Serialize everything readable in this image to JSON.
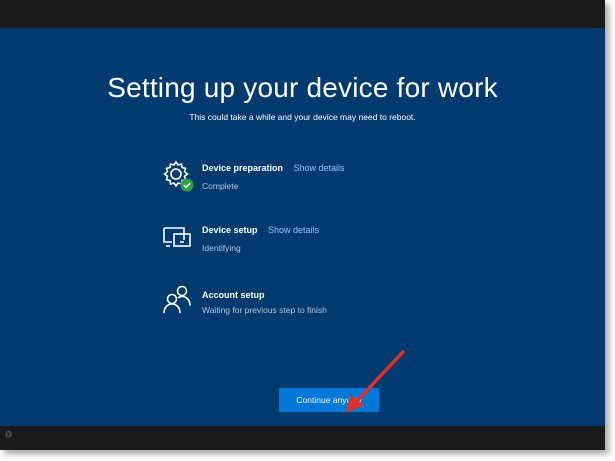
{
  "setup": {
    "title": "Setting up your device for work",
    "subtitle": "This could take a while and your device may need to reboot."
  },
  "steps": [
    {
      "icon": "gear-check-icon",
      "title": "Device preparation",
      "link": "Show details",
      "status": "Complete"
    },
    {
      "icon": "device-icon",
      "title": "Device setup",
      "link": "Show details",
      "status": "Identifying"
    },
    {
      "icon": "account-icon",
      "title": "Account setup",
      "link": "",
      "status": "Waiting for previous step to finish"
    }
  ],
  "actions": {
    "continue_label": "Continue anyway"
  },
  "colors": {
    "background": "#003a6e",
    "button": "#0078d7",
    "link": "#8fc7ff",
    "complete_check": "#2ea043",
    "annotation_arrow": "#e0302a"
  }
}
